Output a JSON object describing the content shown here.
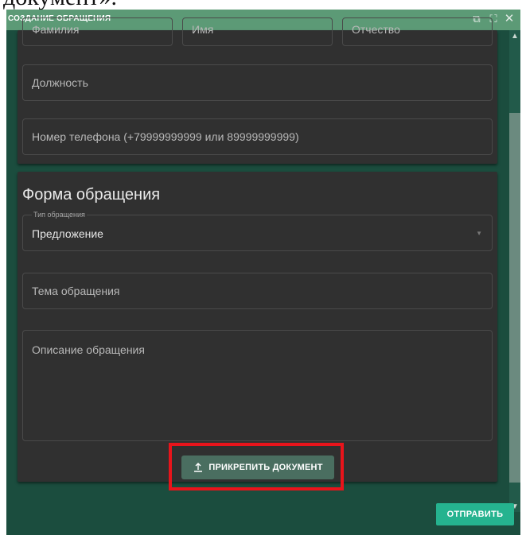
{
  "background_heading": "документ».",
  "window": {
    "title": "СОЗДАНИЕ ОБРАЩЕНИЯ",
    "controls": [
      "restore-icon",
      "fullscreen-icon",
      "close-icon"
    ]
  },
  "contact": {
    "surname_placeholder": "Фамилия",
    "name_placeholder": "Имя",
    "patronymic_placeholder": "Отчество",
    "position_placeholder": "Должность",
    "phone_placeholder": "Номер телефона (+79999999999 или 89999999999)"
  },
  "form": {
    "section_title": "Форма обращения",
    "type_label": "Тип обращения",
    "type_value": "Предложение",
    "subject_placeholder": "Тема обращения",
    "description_placeholder": "Описание обращения",
    "attach_label": "ПРИКРЕПИТЬ ДОКУМЕНТ"
  },
  "footer": {
    "submit_label": "ОТПРАВИТЬ"
  },
  "colors": {
    "window_bg": "#1b4d3e",
    "titlebar": "#5c9a76",
    "card": "#303030",
    "submit": "#25b38f",
    "highlight": "#e8141b"
  }
}
